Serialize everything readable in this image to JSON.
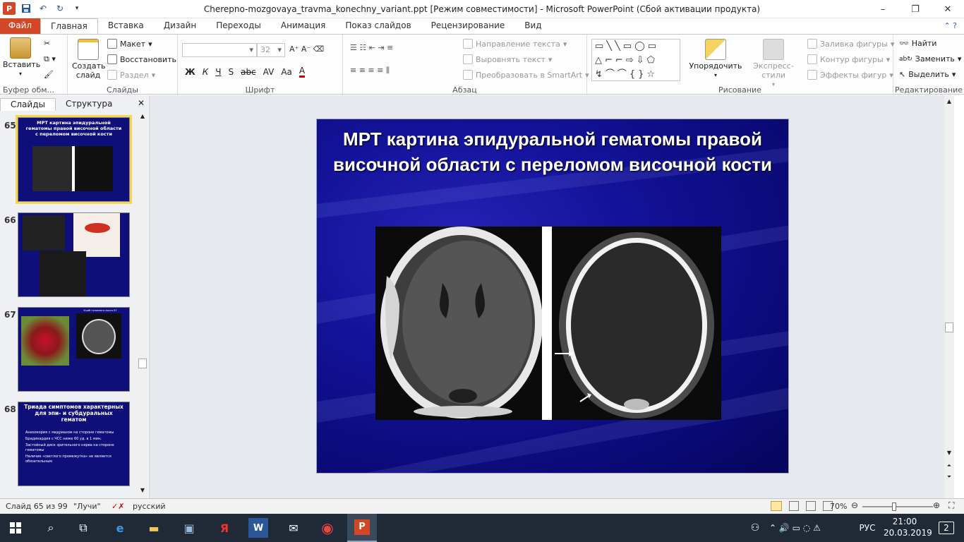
{
  "window": {
    "title": "Cherepno-mozgovaya_travma_konechny_variant.ppt [Режим совместимости]  -  Microsoft PowerPoint (Сбой активации продукта)",
    "app_icon": "powerpoint-icon",
    "minimize": "–",
    "maximize": "❐",
    "close": "✕"
  },
  "ribbon_tabs": [
    "Файл",
    "Главная",
    "Вставка",
    "Дизайн",
    "Переходы",
    "Анимация",
    "Показ слайдов",
    "Рецензирование",
    "Вид"
  ],
  "active_tab": "Главная",
  "ribbon": {
    "clipboard": {
      "label": "Буфер обм...",
      "paste": "Вставить"
    },
    "slides": {
      "label": "Слайды",
      "create": "Создать слайд",
      "layout": "Макет",
      "reset": "Восстановить",
      "section": "Раздел"
    },
    "font": {
      "label": "Шрифт",
      "font_name": "",
      "font_size": "32",
      "bold": "Ж",
      "italic": "К",
      "underline": "Ч",
      "shadow": "S",
      "strike": "abc",
      "spacing": "AV",
      "case": "Aa",
      "color": "A"
    },
    "paragraph": {
      "label": "Абзац",
      "text_direction": "Направление текста",
      "align_text": "Выровнять текст",
      "smartart": "Преобразовать в SmartArt"
    },
    "drawing": {
      "label": "Рисование",
      "arrange": "Упорядочить",
      "quick_styles": "Экспресс-стили",
      "fill": "Заливка фигуры",
      "outline": "Контур фигуры",
      "effects": "Эффекты фигур"
    },
    "editing": {
      "label": "Редактирование",
      "find": "Найти",
      "replace": "Заменить",
      "select": "Выделить"
    }
  },
  "pane": {
    "tabs": [
      "Слайды",
      "Структура"
    ],
    "close": "✕",
    "thumbnails": [
      {
        "num": "65",
        "title": "МРТ картина эпидуральной гематомы правой височной области с переломом височной кости",
        "selected": true
      },
      {
        "num": "66",
        "title": ""
      },
      {
        "num": "67",
        "title": "Ушиб головного мозга КТ"
      },
      {
        "num": "68",
        "title": "Триада симптомов характерных для эпи- и субдуральных гематом",
        "bullets": [
          "Анизокория с мидриазом на стороне гематомы",
          "Брадикардия с ЧСС ниже 60 уд. в 1 мин.",
          "Застойный диск зрительного нерва на стороне гематомы",
          "Наличие «светлого промежутка» не является обязательным"
        ]
      }
    ]
  },
  "slide": {
    "title": "МРТ картина эпидуральной гематомы правой височной области с переломом височной кости"
  },
  "status": {
    "slide_counter": "Слайд 65 из 99",
    "theme": "\"Лучи\"",
    "language": "русский",
    "zoom": "70%",
    "zoom_fraction": 0.45
  },
  "taskbar": {
    "lang": "РУС",
    "time": "21:00",
    "date": "20.03.2019",
    "notifications": "2"
  },
  "colors": {
    "file_tab": "#d24726",
    "slide_bg": "#0f0f7a",
    "taskbar": "#1f2a36",
    "selection": "#f9d54a"
  }
}
